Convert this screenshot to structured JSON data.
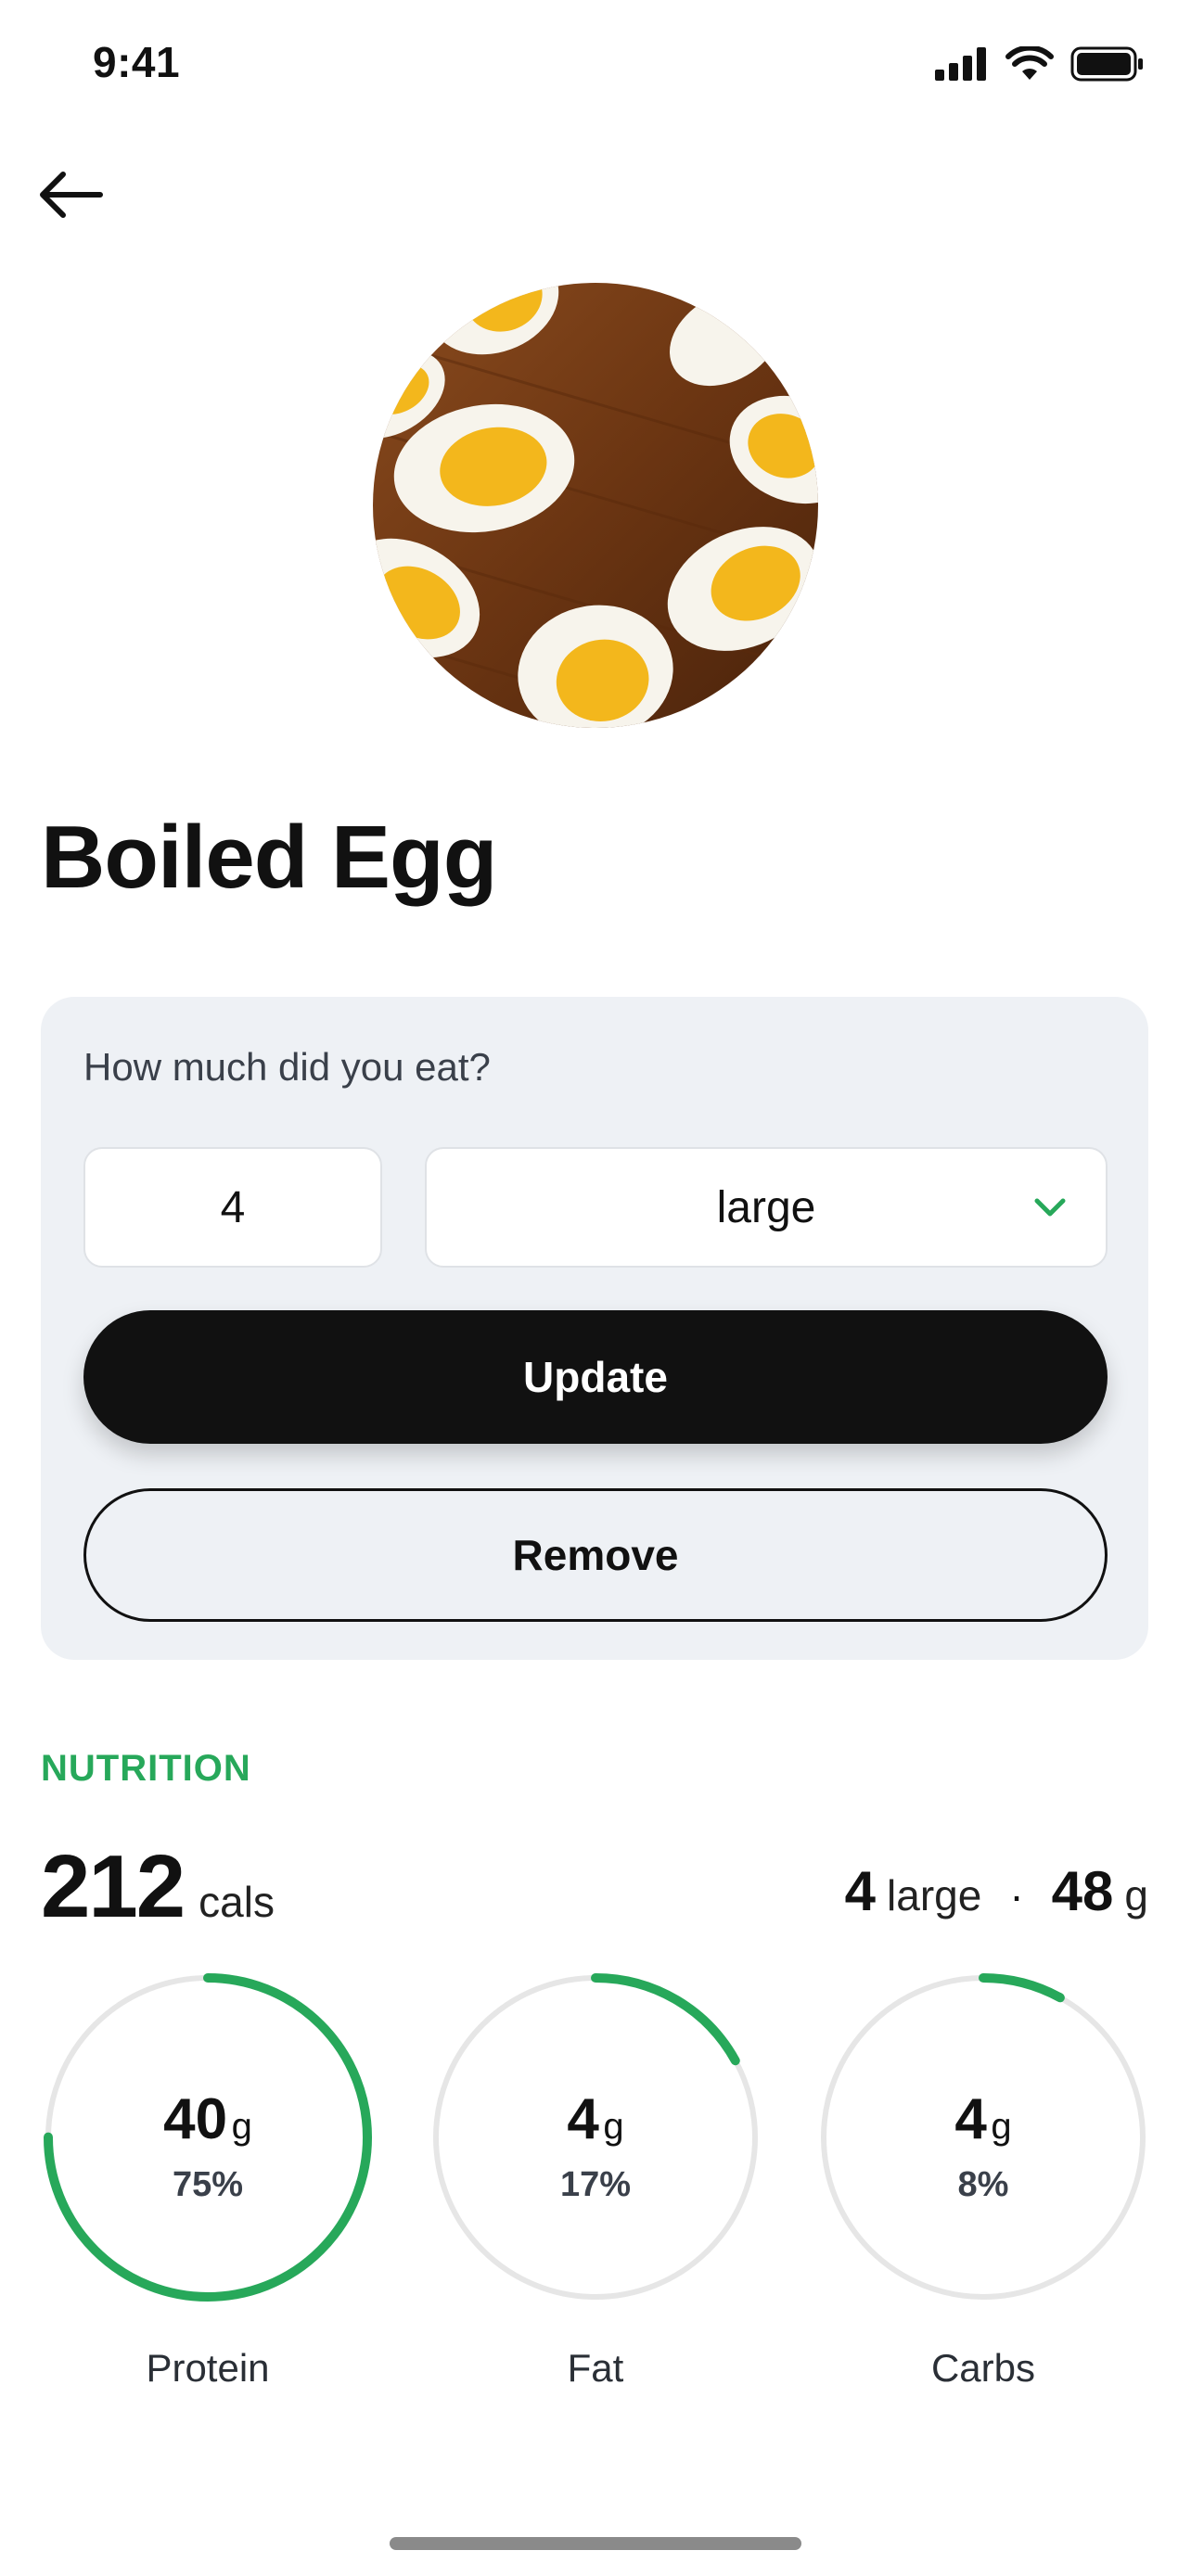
{
  "status_bar": {
    "time": "9:41"
  },
  "food": {
    "name": "Boiled Egg"
  },
  "portion_card": {
    "question": "How much did you eat?",
    "quantity_value": "4",
    "unit_value": "large",
    "update_label": "Update",
    "remove_label": "Remove"
  },
  "nutrition": {
    "section_label": "NUTRITION",
    "calories_value": "212",
    "calories_unit": "cals",
    "serving_count": "4",
    "serving_unit": "large",
    "separator": "·",
    "weight_value": "48",
    "weight_unit": "g",
    "macros": [
      {
        "label": "Protein",
        "grams": "40",
        "unit": "g",
        "percent_text": "75%",
        "percent": 75
      },
      {
        "label": "Fat",
        "grams": "4",
        "unit": "g",
        "percent_text": "17%",
        "percent": 17
      },
      {
        "label": "Carbs",
        "grams": "4",
        "unit": "g",
        "percent_text": "8%",
        "percent": 8
      }
    ]
  },
  "colors": {
    "accent_green": "#27a85a",
    "ring_track": "#e6e6e6",
    "card_bg": "#eef1f5",
    "primary_button": "#111111"
  },
  "icons": {
    "back": "arrow-left-icon",
    "unit_dropdown": "chevron-down-icon",
    "signal": "cellular-signal-icon",
    "wifi": "wifi-icon",
    "battery": "battery-icon"
  }
}
